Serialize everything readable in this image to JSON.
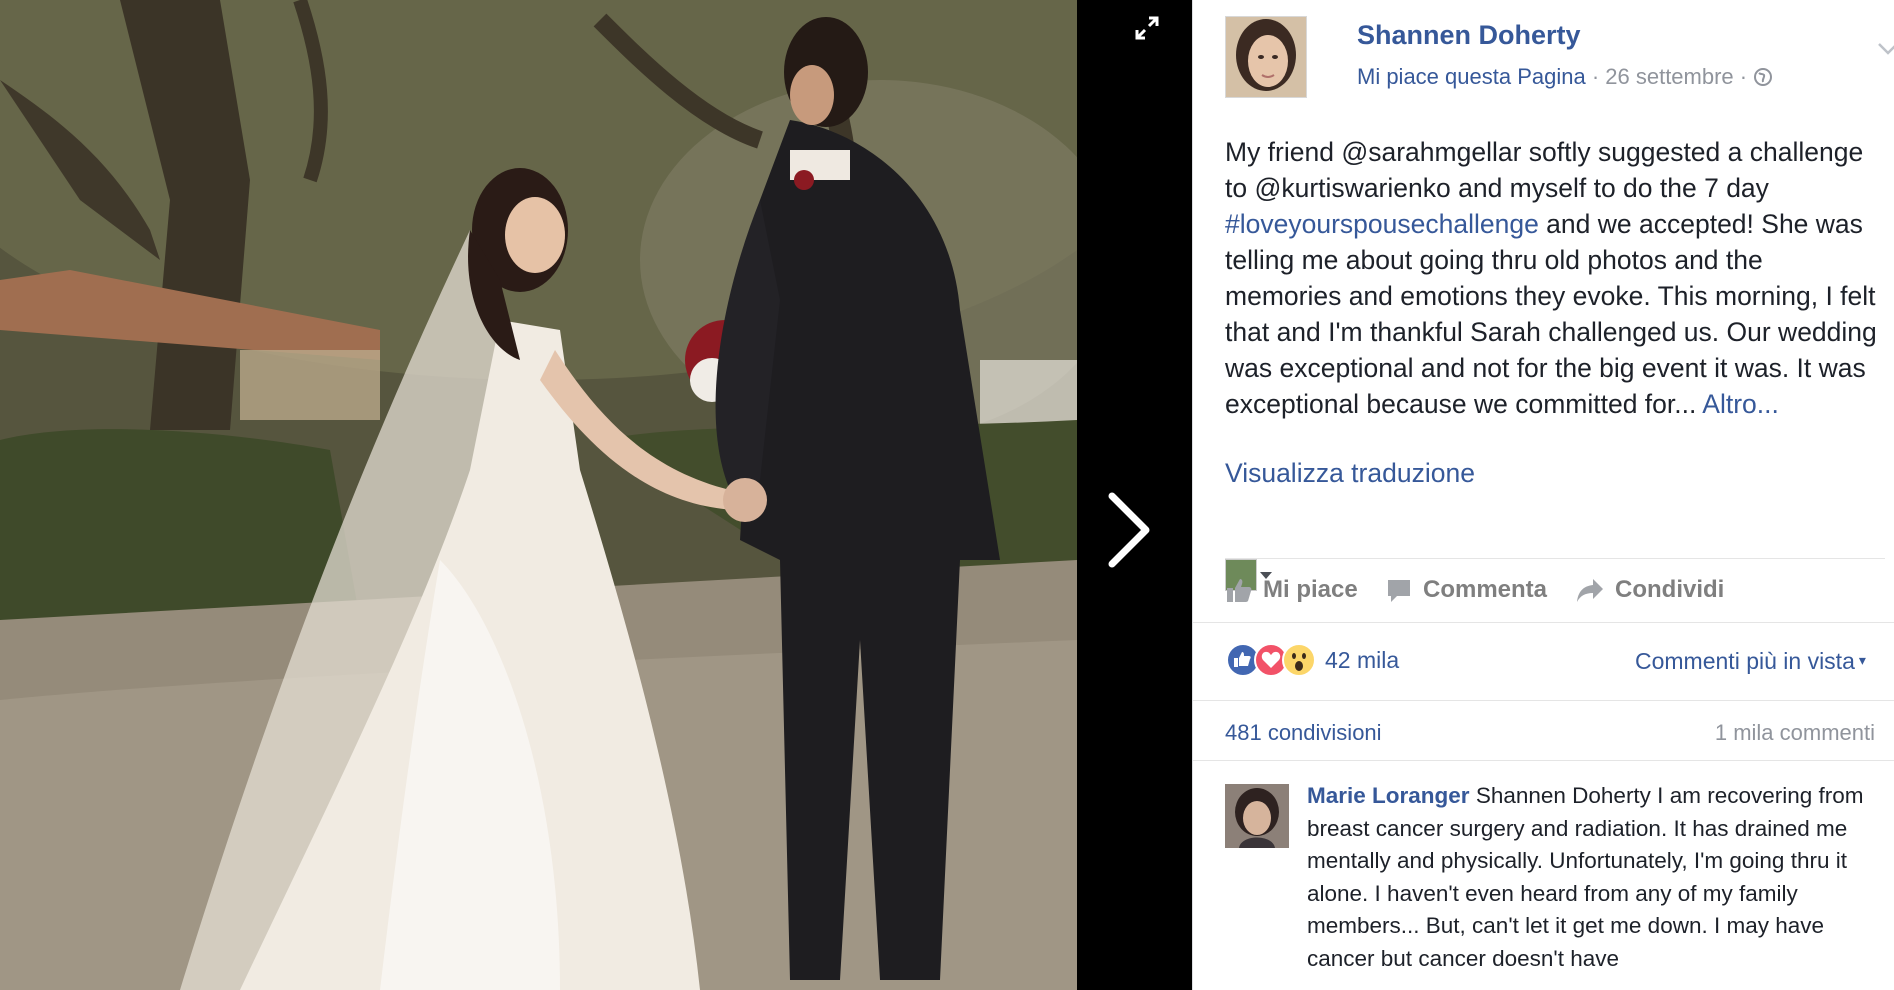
{
  "viewer": {
    "photo_icon": "wedding-photo-image",
    "expand_icon": "expand-icon",
    "next_icon": "chevron-right-icon"
  },
  "post": {
    "page_name": "Shannen Doherty",
    "like_page": "Mi piace questa Pagina",
    "separator": " · ",
    "date": "26 settembre",
    "text_before_hashtag": "My friend @sarahmgellar softly suggested a challenge to @kurtiswarienko and myself to do the 7 day ",
    "hashtag": "#loveyourspousechallenge",
    "text_after_hashtag": " and we accepted! She was telling me about going thru old photos and the memories and emotions they evoke. This morning, I felt that and I'm thankful Sarah challenged us. Our wedding was exceptional and not for the big event it was. It was exceptional because we committed for...",
    "more_link": "Altro...",
    "translate_link": "Visualizza traduzione"
  },
  "actions": {
    "like": "Mi piace",
    "comment": "Commenta",
    "share": "Condividi"
  },
  "reactions": {
    "icons": [
      "like-reaction-icon",
      "love-reaction-icon",
      "wow-reaction-icon"
    ],
    "count": "42 mila",
    "sort_label": "Commenti più in vista",
    "sort_caret": "▾"
  },
  "stats": {
    "shares": "481 condivisioni",
    "comments": "1 mila commenti"
  },
  "comment": {
    "author": "Marie Loranger",
    "text": "Shannen Doherty I am recovering from breast cancer surgery and radiation. It has drained me mentally and physically. Unfortunately, I'm going thru it alone. I haven't even heard from any of my family members... But, can't let it get me down. I may have cancer but cancer doesn't have"
  },
  "colors": {
    "link": "#365899",
    "text": "#1d2129",
    "muted": "#90949c",
    "like_blue": "#4267b2",
    "love_red": "#f25268",
    "wow_yellow": "#fcd669"
  }
}
